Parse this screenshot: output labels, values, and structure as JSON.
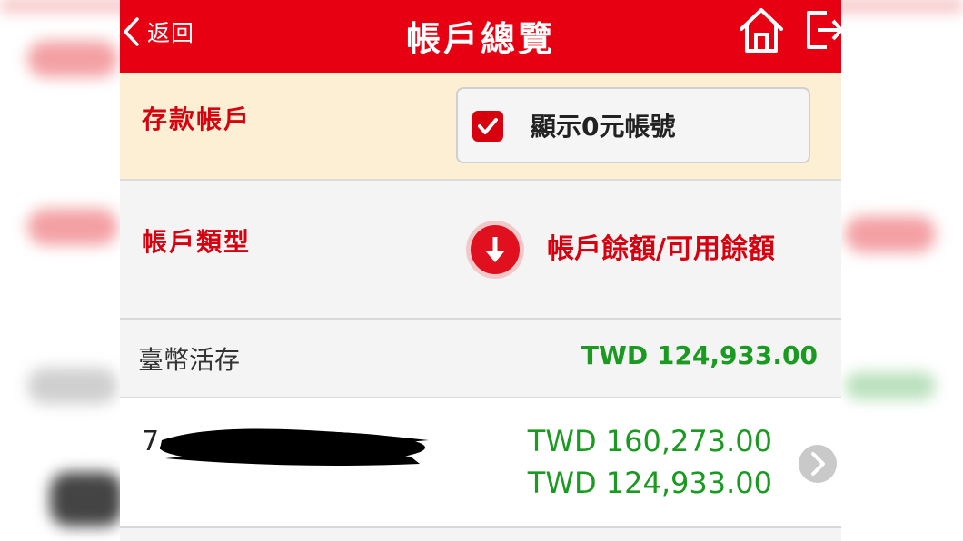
{
  "header": {
    "back_label": "返回",
    "title": "帳戶總覽",
    "icons": [
      "home-icon",
      "logout-icon"
    ]
  },
  "deposit_section": {
    "label": "存款帳戶",
    "show_zero": {
      "label": "顯示0元帳號",
      "checked": true
    }
  },
  "type_section": {
    "label": "帳戶類型",
    "sort_label": "帳戶餘額/可用餘額",
    "sort_icon": "arrow-down-circle-icon"
  },
  "accounts": [
    {
      "type": "臺幣活存",
      "total": "TWD 124,933.00",
      "rows": [
        {
          "number_visible": "7",
          "balance": "TWD 160,273.00",
          "available": "TWD 124,933.00"
        }
      ]
    }
  ],
  "colors": {
    "brand_red": "#e60012",
    "amount_green": "#1a9a20",
    "deposit_bg": "#fcefd4"
  }
}
